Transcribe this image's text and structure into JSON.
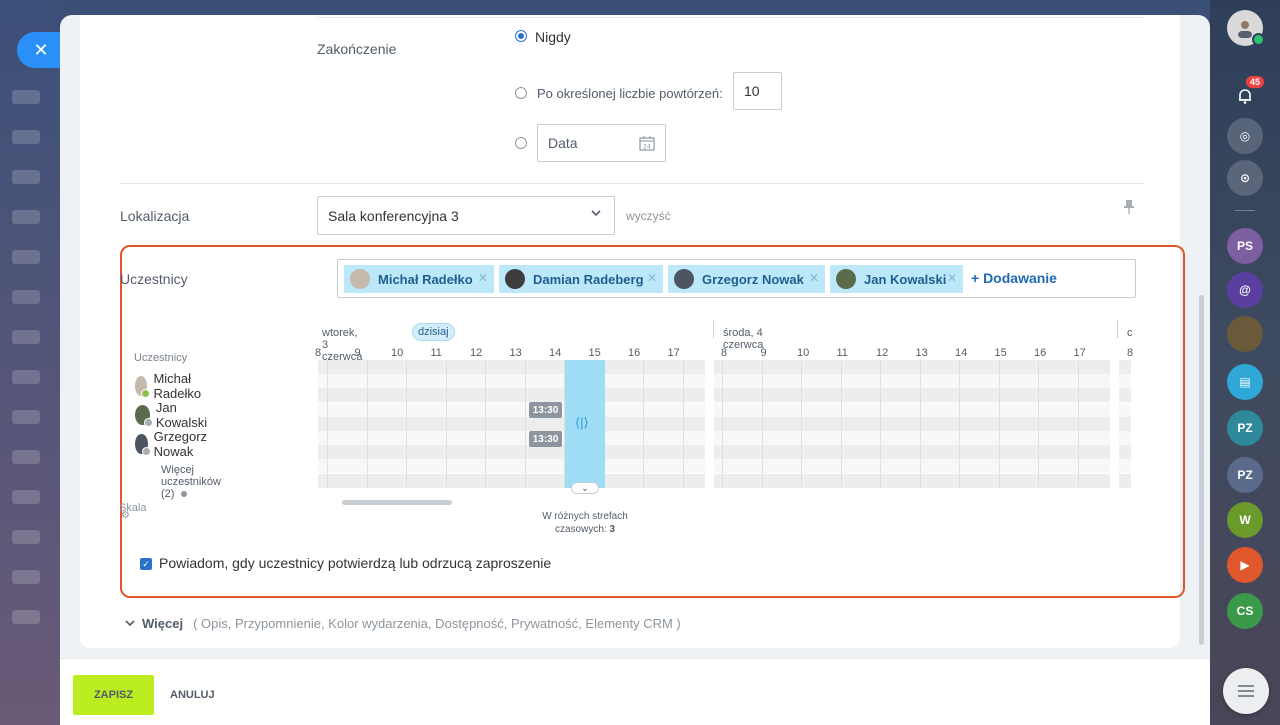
{
  "recurrence": {
    "end_label": "Zakończenie",
    "never": "Nigdy",
    "after_count": "Po określonej liczbie powtórzeń:",
    "count_value": "10",
    "date_placeholder": "Data"
  },
  "location": {
    "label": "Lokalizacja",
    "value": "Sala konferencyjna 3",
    "clear": "wyczyść"
  },
  "participants": {
    "label": "Uczestnicy",
    "chips": [
      "Michał Radełko",
      "Damian Radeberg",
      "Grzegorz Nowak",
      "Jan Kowalski"
    ],
    "add": "+ Dodawanie"
  },
  "planner": {
    "day1": "wtorek, 3 czerwca",
    "today": "dzisiaj",
    "day2": "środa, 4 czerwca",
    "day3_partial": "c",
    "hours_day1": [
      "8",
      "9",
      "10",
      "11",
      "12",
      "13",
      "14",
      "15",
      "16",
      "17"
    ],
    "hours_day2": [
      "8",
      "9",
      "10",
      "11",
      "12",
      "13",
      "14",
      "15",
      "16",
      "17"
    ],
    "hour_day3_partial": "8",
    "participants_header": "Uczestnicy",
    "people": [
      "Michał Radełko",
      "Jan Kowalski",
      "Grzegorz Nowak"
    ],
    "more_people": "Więcej uczestników (2)",
    "scale": "Skala",
    "busy_badge": "13:30",
    "timezones_line1": "W różnych strefach",
    "timezones_line2": "czasowych:",
    "timezones_count": "3"
  },
  "notify_checkbox": "Powiadom, gdy uczestnicy potwierdzą lub odrzucą zaproszenie",
  "more": {
    "label": "Więcej",
    "items": "( Opis,  Przypomnienie,  Kolor wydarzenia,  Dostępność,  Prywatność,  Elementy CRM )"
  },
  "footer": {
    "save": "ZAPISZ",
    "cancel": "ANULUJ"
  },
  "sidebar": {
    "notifications_badge": "45",
    "items": [
      "PS",
      "PZ",
      "PZ",
      "W",
      "CS"
    ]
  },
  "colors": {
    "accent": "#2a72c8",
    "save_button": "#bbed21",
    "highlight_border": "#e0572d",
    "chip_bg": "#bde8f9",
    "selection": "#9fdcf6"
  }
}
